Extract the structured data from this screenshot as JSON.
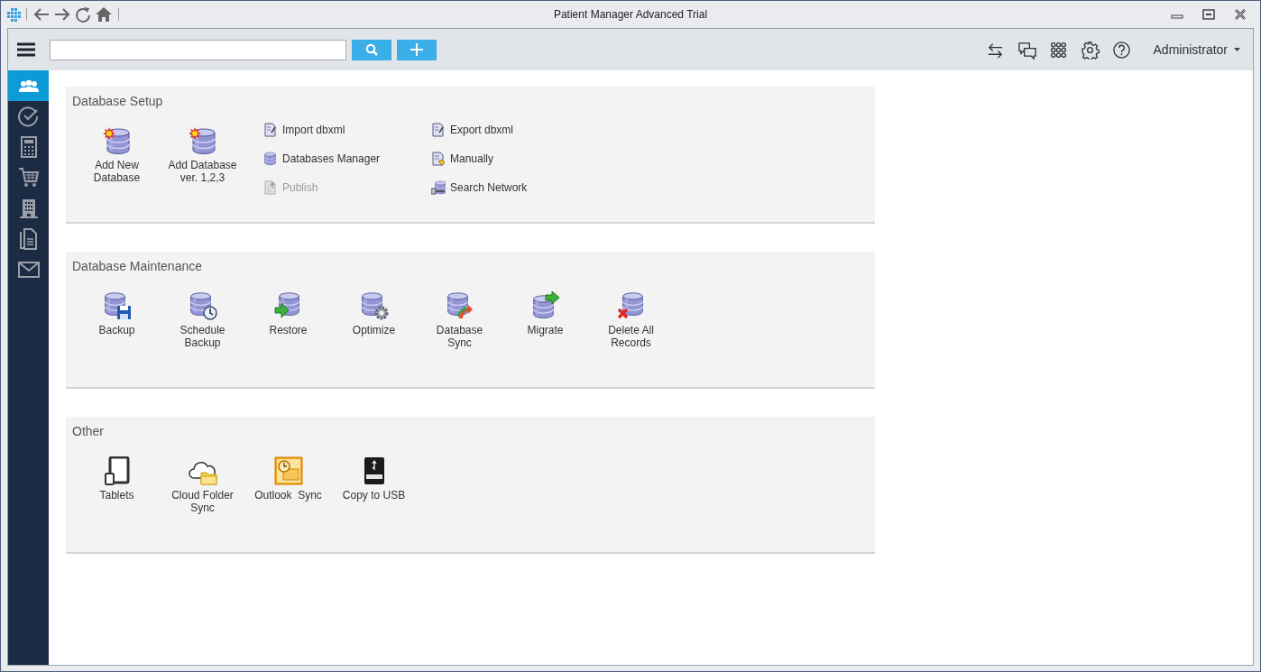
{
  "window": {
    "title": "Patient Manager Advanced Trial",
    "nav": [
      {
        "kind": "back"
      },
      {
        "kind": "forward"
      },
      {
        "kind": "refresh"
      },
      {
        "kind": "home"
      }
    ],
    "controls": [
      {
        "kind": "minimize"
      },
      {
        "kind": "maximize"
      },
      {
        "kind": "close"
      }
    ]
  },
  "toolbar": {
    "tools": [
      {
        "kind": "swap"
      },
      {
        "kind": "chat"
      },
      {
        "kind": "apps"
      },
      {
        "kind": "settings"
      },
      {
        "kind": "help"
      }
    ],
    "user_menu": {
      "label": "Administrator"
    }
  },
  "sidebar": {
    "items": [
      {
        "kind": "people",
        "selected": true
      },
      {
        "kind": "check",
        "selected": false
      },
      {
        "kind": "calculator",
        "selected": false
      },
      {
        "kind": "cart",
        "selected": false
      },
      {
        "kind": "building",
        "selected": false
      },
      {
        "kind": "documents",
        "selected": false
      },
      {
        "kind": "mail",
        "selected": false
      }
    ]
  },
  "sections": [
    {
      "title": "Database Setup",
      "items": [
        {
          "kind": "db-new",
          "label": "Add New\nDatabase"
        },
        {
          "kind": "db-new",
          "label": "Add Database\nver. 1,2,3"
        }
      ],
      "links": [
        {
          "kind": "import",
          "label": "Import dbxml",
          "disabled": false
        },
        {
          "kind": "db-stack",
          "label": "Databases Manager",
          "disabled": false
        },
        {
          "kind": "publish",
          "label": "Publish",
          "disabled": true
        },
        {
          "kind": "export",
          "label": "Export dbxml",
          "disabled": false
        },
        {
          "kind": "manual",
          "label": "Manually",
          "disabled": false
        },
        {
          "kind": "network",
          "label": "Search Network",
          "disabled": false
        }
      ]
    },
    {
      "title": "Database Maintenance",
      "items": [
        {
          "kind": "db-backup",
          "label": "Backup"
        },
        {
          "kind": "db-schedule",
          "label": "Schedule\nBackup"
        },
        {
          "kind": "db-restore",
          "label": "Restore"
        },
        {
          "kind": "db-optimize",
          "label": "Optimize"
        },
        {
          "kind": "db-sync",
          "label": "Database\nSync"
        },
        {
          "kind": "db-migrate",
          "label": "Migrate"
        },
        {
          "kind": "db-delete",
          "label": "Delete All\nRecords"
        }
      ]
    },
    {
      "title": "Other",
      "items": [
        {
          "kind": "tablet",
          "label": "Tablets"
        },
        {
          "kind": "cloud",
          "label": "Cloud Folder\nSync"
        },
        {
          "kind": "outlook",
          "label": "Outlook  Sync"
        },
        {
          "kind": "usb",
          "label": "Copy to USB"
        }
      ]
    }
  ]
}
